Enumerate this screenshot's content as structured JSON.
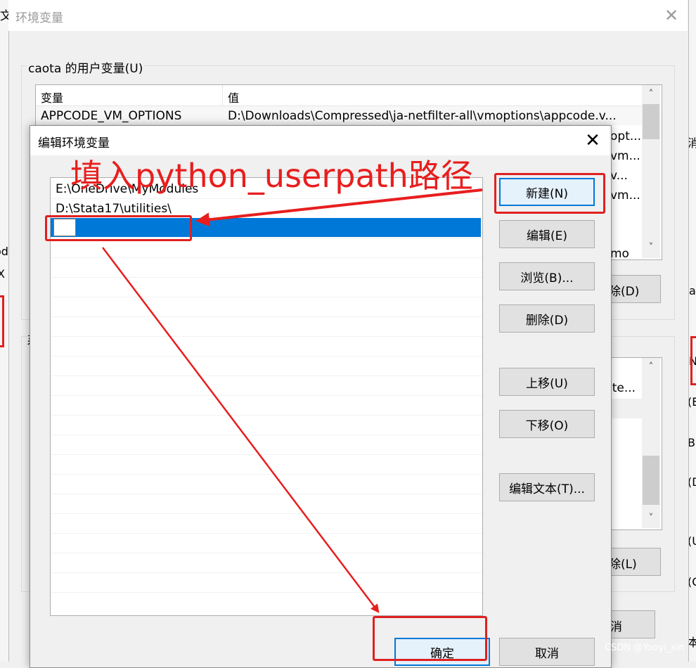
{
  "background": {
    "left_peek_char": "文",
    "left_peek_items": [
      "od",
      "X"
    ],
    "right_peek_items": [
      "消",
      "a",
      "N",
      "(E",
      "B)",
      "(D",
      "(U",
      "(O",
      "本"
    ]
  },
  "outer_dialog": {
    "title": "环境变量",
    "close_glyph": "✕",
    "user_group_label": "caota 的用户变量(U)",
    "system_group_label_peek": "系",
    "columns": {
      "variable": "变量",
      "value": "值"
    },
    "user_rows": [
      {
        "variable": "APPCODE_VM_OPTIONS",
        "value": "D:\\Downloads\\Compressed\\ja-netfilter-all\\vmoptions\\appcode.v..."
      }
    ],
    "user_value_peeks": [
      "opt...",
      "vm...",
      "v...",
      "vm...",
      "mo"
    ],
    "user_delete_button": "除(D)",
    "system_value_peek": "ite...",
    "system_delete_button": "除(L)",
    "cancel_button_peek": "消"
  },
  "edit_dialog": {
    "title": "编辑环境变量",
    "close_glyph": "✕",
    "paths": [
      "E:\\OneDrive\\MyModules",
      "D:\\Stata17\\utilities\\",
      ""
    ],
    "buttons": {
      "new": "新建(N)",
      "edit": "编辑(E)",
      "browse": "浏览(B)...",
      "delete": "删除(D)",
      "move_up": "上移(U)",
      "move_down": "下移(O)",
      "edit_text": "编辑文本(T)...",
      "ok": "确定",
      "cancel": "取消"
    }
  },
  "annotation": {
    "text": "填入python_userpath路径",
    "color": "#e81e1e"
  },
  "watermark": "CSDN @Yooyi_xin",
  "colors": {
    "selection": "#0078d7",
    "focus_border": "#0078d7"
  }
}
